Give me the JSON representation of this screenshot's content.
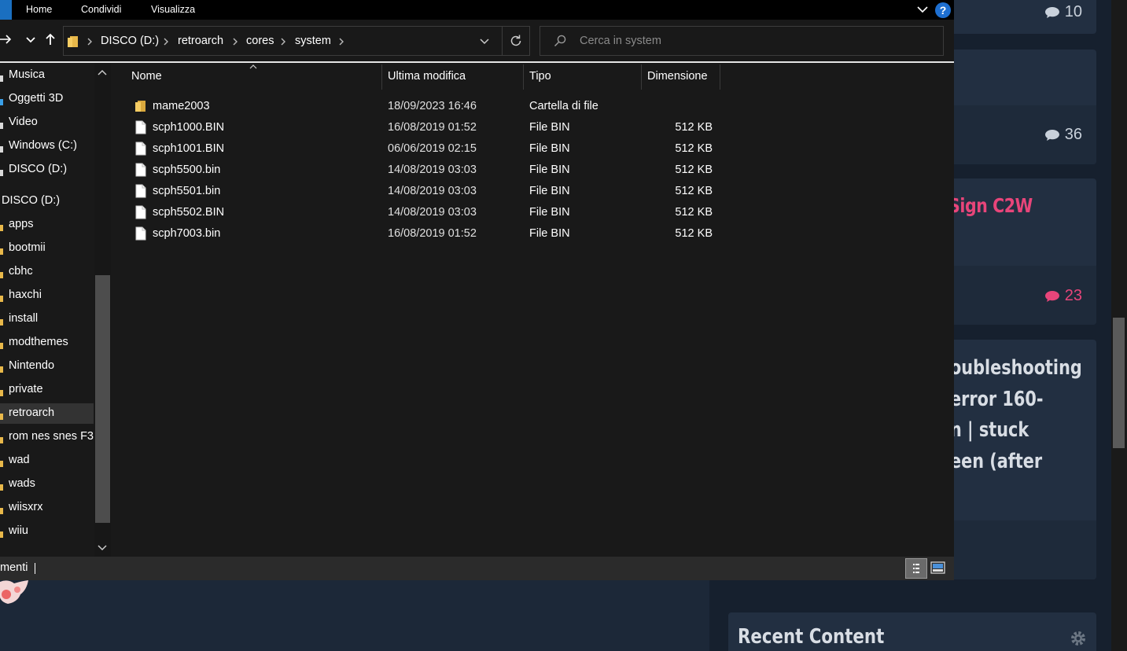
{
  "explorer": {
    "ribbon_tabs": [
      "Home",
      "Condividi",
      "Visualizza"
    ],
    "help_label": "?",
    "breadcrumbs": [
      "DISCO (D:)",
      "retroarch",
      "cores",
      "system"
    ],
    "search_placeholder": "Cerca in system",
    "columns": [
      "Nome",
      "Ultima modifica",
      "Tipo",
      "Dimensione"
    ],
    "sidebar": [
      {
        "label": "Musica",
        "icon": "music-icon"
      },
      {
        "label": "Oggetti 3D",
        "icon": "cube-icon"
      },
      {
        "label": "Video",
        "icon": "video-icon"
      },
      {
        "label": "Windows (C:)",
        "icon": "drive-icon"
      },
      {
        "label": "DISCO (D:)",
        "icon": "drive-icon"
      },
      {
        "label": "DISCO (D:)",
        "icon": "drive-icon"
      },
      {
        "label": "apps",
        "icon": "folder-icon"
      },
      {
        "label": "bootmii",
        "icon": "folder-icon"
      },
      {
        "label": "cbhc",
        "icon": "folder-icon"
      },
      {
        "label": "haxchi",
        "icon": "folder-icon"
      },
      {
        "label": "install",
        "icon": "folder-icon"
      },
      {
        "label": "modthemes",
        "icon": "folder-icon"
      },
      {
        "label": "Nintendo",
        "icon": "folder-icon"
      },
      {
        "label": "private",
        "icon": "folder-icon"
      },
      {
        "label": "retroarch",
        "icon": "folder-icon",
        "selected": true
      },
      {
        "label": "rom nes snes F3",
        "icon": "folder-icon"
      },
      {
        "label": "wad",
        "icon": "folder-icon"
      },
      {
        "label": "wads",
        "icon": "folder-icon"
      },
      {
        "label": "wiisxrx",
        "icon": "folder-icon"
      },
      {
        "label": "wiiu",
        "icon": "folder-icon"
      }
    ],
    "files": [
      {
        "name": "mame2003",
        "modified": "18/09/2023 16:46",
        "type": "Cartella di file",
        "size": "",
        "icon": "folder-icon"
      },
      {
        "name": "scph1000.BIN",
        "modified": "16/08/2019 01:52",
        "type": "File BIN",
        "size": "512 KB",
        "icon": "file-icon"
      },
      {
        "name": "scph1001.BIN",
        "modified": "06/06/2019 02:15",
        "type": "File BIN",
        "size": "512 KB",
        "icon": "file-icon"
      },
      {
        "name": "scph5500.bin",
        "modified": "14/08/2019 03:03",
        "type": "File BIN",
        "size": "512 KB",
        "icon": "file-icon"
      },
      {
        "name": "scph5501.bin",
        "modified": "14/08/2019 03:03",
        "type": "File BIN",
        "size": "512 KB",
        "icon": "file-icon"
      },
      {
        "name": "scph5502.BIN",
        "modified": "14/08/2019 03:03",
        "type": "File BIN",
        "size": "512 KB",
        "icon": "file-icon"
      },
      {
        "name": "scph7003.bin",
        "modified": "16/08/2019 01:52",
        "type": "File BIN",
        "size": "512 KB",
        "icon": "file-icon"
      }
    ],
    "status_text": "menti"
  },
  "webpage": {
    "card1_comments": "10",
    "card2_comments": "36",
    "card3_title": "Sign C2W",
    "card3_comments": "23",
    "card4_lines": [
      "oubleshooting",
      "error 160-",
      "n | stuck",
      "een (after"
    ],
    "recent_content_title": "Recent Content"
  },
  "colors": {
    "accent_blue": "#1e6fd0",
    "pink": "#e8457a",
    "folder_yellow": "#e8b84a",
    "explorer_bg": "#191919",
    "web_card_bg": "#222f41"
  }
}
